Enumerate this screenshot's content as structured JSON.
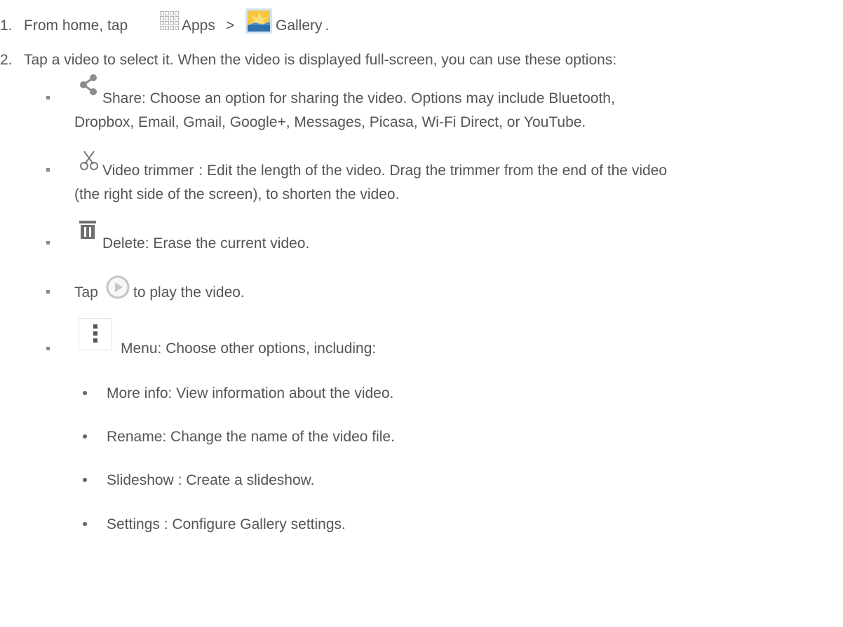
{
  "steps": [
    {
      "number": "1.",
      "text_before": "From home, tap",
      "apps_label": "Apps",
      "arrow": ">",
      "gallery_label": "Gallery",
      "end": "."
    },
    {
      "number": "2.",
      "text": "Tap a video to select it. When the video is displayed full-screen, you can use these options:"
    }
  ],
  "options": {
    "share": {
      "icon": "share-icon",
      "label": "Share",
      "line1": ": Choose an option for sharing the video. Options may include Bluetooth,",
      "line2": "Dropbox, Email, Gmail, Google+, Messages, Picasa, Wi-Fi Direct, or YouTube."
    },
    "trimmer": {
      "icon": "scissors-icon",
      "label": "Video trimmer",
      "line1": ": Edit the length of the video. Drag the trimmer from the end of the video",
      "line2": "(the right side of the screen), to shorten the video."
    },
    "delete": {
      "icon": "trash-icon",
      "label": "Delete",
      "text": ": Erase the current video."
    },
    "play": {
      "icon": "play-icon",
      "before": "Tap",
      "after": "to play the video."
    },
    "menu": {
      "icon": "menu-icon",
      "label": "Menu",
      "text": ": Choose other options, including:",
      "items": [
        {
          "label": "More info",
          "text": ": View information about the video."
        },
        {
          "label": "Rename",
          "text": ": Change the name of the video file."
        },
        {
          "label": "Slideshow",
          "text": " : Create a slideshow."
        },
        {
          "label": "Settings",
          "text": " : Configure Gallery settings."
        }
      ]
    }
  }
}
